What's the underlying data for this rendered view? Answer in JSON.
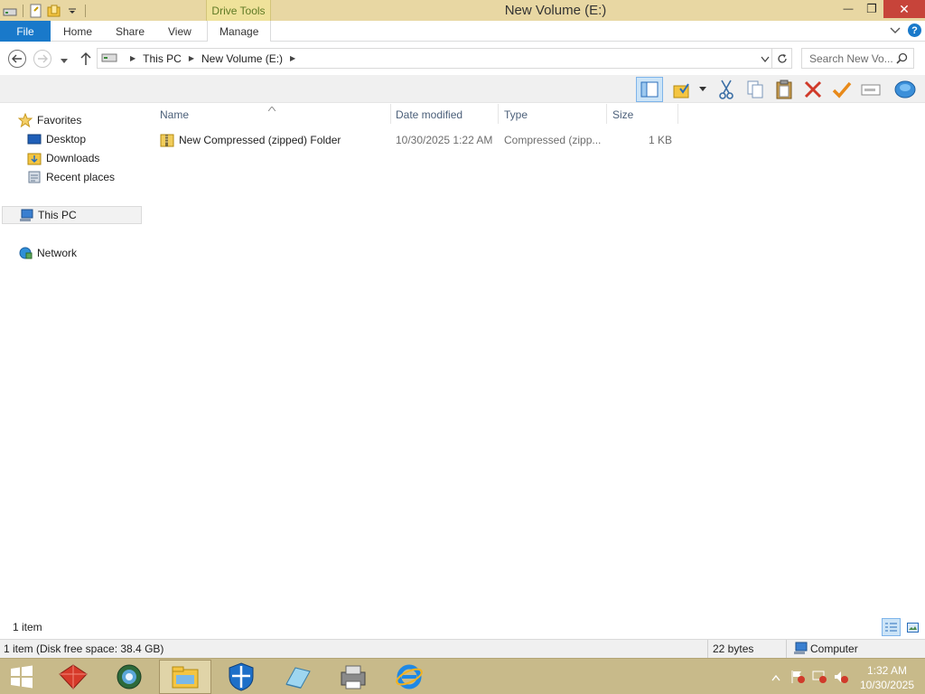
{
  "window": {
    "title": "New Volume (E:)",
    "context_tab": "Drive Tools",
    "minimize_glyph": "—",
    "restore_glyph": "❐",
    "close_glyph": "✕"
  },
  "ribbon": {
    "tabs": [
      "File",
      "Home",
      "Share",
      "View",
      "Manage"
    ],
    "help_glyph": "?"
  },
  "address": {
    "crumbs": [
      "This PC",
      "New Volume (E:)"
    ],
    "search_placeholder": "Search New Vo..."
  },
  "nav": {
    "favorites": "Favorites",
    "favorites_items": [
      "Desktop",
      "Downloads",
      "Recent places"
    ],
    "this_pc": "This PC",
    "network": "Network"
  },
  "columns": [
    "Name",
    "Date modified",
    "Type",
    "Size"
  ],
  "files": [
    {
      "name": "New Compressed (zipped) Folder",
      "date": "10/30/2025 1:22 AM",
      "type": "Compressed (zipp...",
      "size": "1 KB"
    }
  ],
  "status": {
    "items": "1 item",
    "details": "1 item (Disk free space: 38.4 GB)",
    "bytes": "22 bytes",
    "computer": "Computer"
  },
  "clock": {
    "time": "1:32 AM",
    "date": "10/30/2025"
  },
  "colors": {
    "titlebar": "#e8d7a3",
    "file_tab": "#1979ca",
    "close_button": "#c7443a",
    "taskbar": "#c8ba8a"
  }
}
